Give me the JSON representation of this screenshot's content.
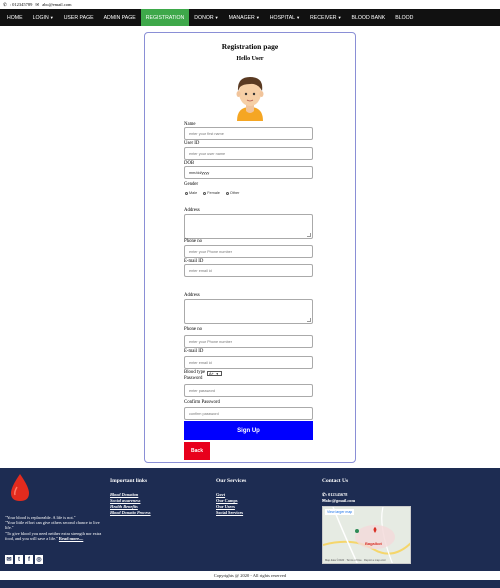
{
  "topbar": {
    "phone": ": 012345789",
    "email": "abc@email.com"
  },
  "nav": {
    "items": [
      {
        "label": "HOME",
        "dropdown": false
      },
      {
        "label": "LOGIN",
        "dropdown": true
      },
      {
        "label": "USER PAGE",
        "dropdown": false
      },
      {
        "label": "ADMIN PAGE",
        "dropdown": false
      },
      {
        "label": "REGISTRATION",
        "dropdown": false,
        "active": true
      },
      {
        "label": "DONOR",
        "dropdown": true
      },
      {
        "label": "MANAGER",
        "dropdown": true
      },
      {
        "label": "HOSPITAL",
        "dropdown": true
      },
      {
        "label": "RECEIVER",
        "dropdown": true
      },
      {
        "label": "BLOOD BANK",
        "dropdown": false
      },
      {
        "label": "BLOOD",
        "dropdown": false
      }
    ],
    "active_color": "#3ea84a"
  },
  "form": {
    "title": "Registration page",
    "greeting": "Hello User",
    "name_label": "Name",
    "name_placeholder": "enter your first name",
    "userid_label": "User ID",
    "userid_placeholder": "enter your user name",
    "dob_label": "DOB",
    "dob_placeholder": "mm/dd/yyyy",
    "gender_label": "Gender",
    "gender_options": [
      "Male",
      "Female",
      "Other"
    ],
    "address_label": "Address",
    "phone_label": "Phone no",
    "phone_placeholder": "enter your Phone number",
    "email_label": "E-mail ID",
    "email_placeholder": "enter email id",
    "address2_label": "Address",
    "phone2_label": "Phone no",
    "phone2_placeholder": "enter your Phone number",
    "email2_label": "E-mail ID",
    "email2_placeholder": "enter email id",
    "bloodtype_label": "Blood type",
    "bloodtype_value": "A+",
    "password_label": "Password",
    "password_placeholder": "enter password",
    "confirm_label": "Confirm Password",
    "confirm_placeholder": "confirm password",
    "signup_label": "Sign Up",
    "back_label": "Back",
    "signup_color": "#0000ff",
    "back_color": "#e8001c"
  },
  "footer": {
    "bg_color": "#1d2c52",
    "quote_lines": [
      "\"Your blood is replaceable. A life is not.\"",
      "\"Your little effort can give others second chance to live life.\"",
      "\"To give blood you need neither extra strength nor extra food, and you will save a life.\""
    ],
    "read_more": "Read more....",
    "important_title": "Important links",
    "important_links": [
      "Blood Donation",
      "Social awareness",
      "Health Benefits",
      "Blood Donatio Process"
    ],
    "services_title": "Our Services",
    "services_links": [
      "Govt",
      "Our Camps",
      "Our Users",
      "Social Services"
    ],
    "contact_title": "Contact Us",
    "contact_phone": ": 012345678",
    "contact_email": "abc@gmail.com",
    "map_view_larger": "View larger map",
    "map_place": "Bagalkot",
    "map_footer": "Map data ©2020 · Terms of Use · Report a map error",
    "copyright": "Copyrights @ 2020 - All rights reserved"
  }
}
